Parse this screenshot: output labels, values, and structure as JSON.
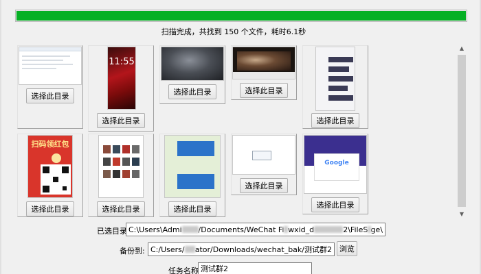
{
  "progress": {
    "percent": 100,
    "fill_color": "#06b025"
  },
  "status_text": "扫描完成，共找到 150 个文件，耗时6.1秒",
  "thumbnails": [
    {
      "button_label": "选择此目录",
      "kind": "window-screenshot"
    },
    {
      "button_label": "选择此目录",
      "kind": "phone-lockscreen",
      "clock_text": "11:55"
    },
    {
      "button_label": "选择此目录",
      "kind": "dark-photo"
    },
    {
      "button_label": "选择此目录",
      "kind": "video-frame"
    },
    {
      "button_label": "选择此目录",
      "kind": "feed-screenshot"
    },
    {
      "button_label": "选择此目录",
      "kind": "red-envelope-poster",
      "poster_title": "扫码领红包"
    },
    {
      "button_label": "选择此目录",
      "kind": "gallery-screenshot"
    },
    {
      "button_label": "选择此目录",
      "kind": "chat-screenshot"
    },
    {
      "button_label": "选择此目录",
      "kind": "dialog-screenshot"
    },
    {
      "button_label": "选择此目录",
      "kind": "google-page",
      "google_text": "Google"
    }
  ],
  "selected_dir": {
    "label": "已选目录:",
    "value_prefix": "C:\\Users\\Admi",
    "value_mid1": "/Documents/WeChat Fi",
    "value_mid2": "wxid_d",
    "value_suffix": "2\\FileS",
    "value_tail": "ge\\"
  },
  "backup_to": {
    "label": "备份到:",
    "value_prefix": "C:/Users/",
    "value_suffix": "ator/Downloads/wechat_bak/测试群2",
    "browse_label": "浏览"
  },
  "task_name": {
    "label": "任务名称:",
    "value": "测试群2"
  }
}
